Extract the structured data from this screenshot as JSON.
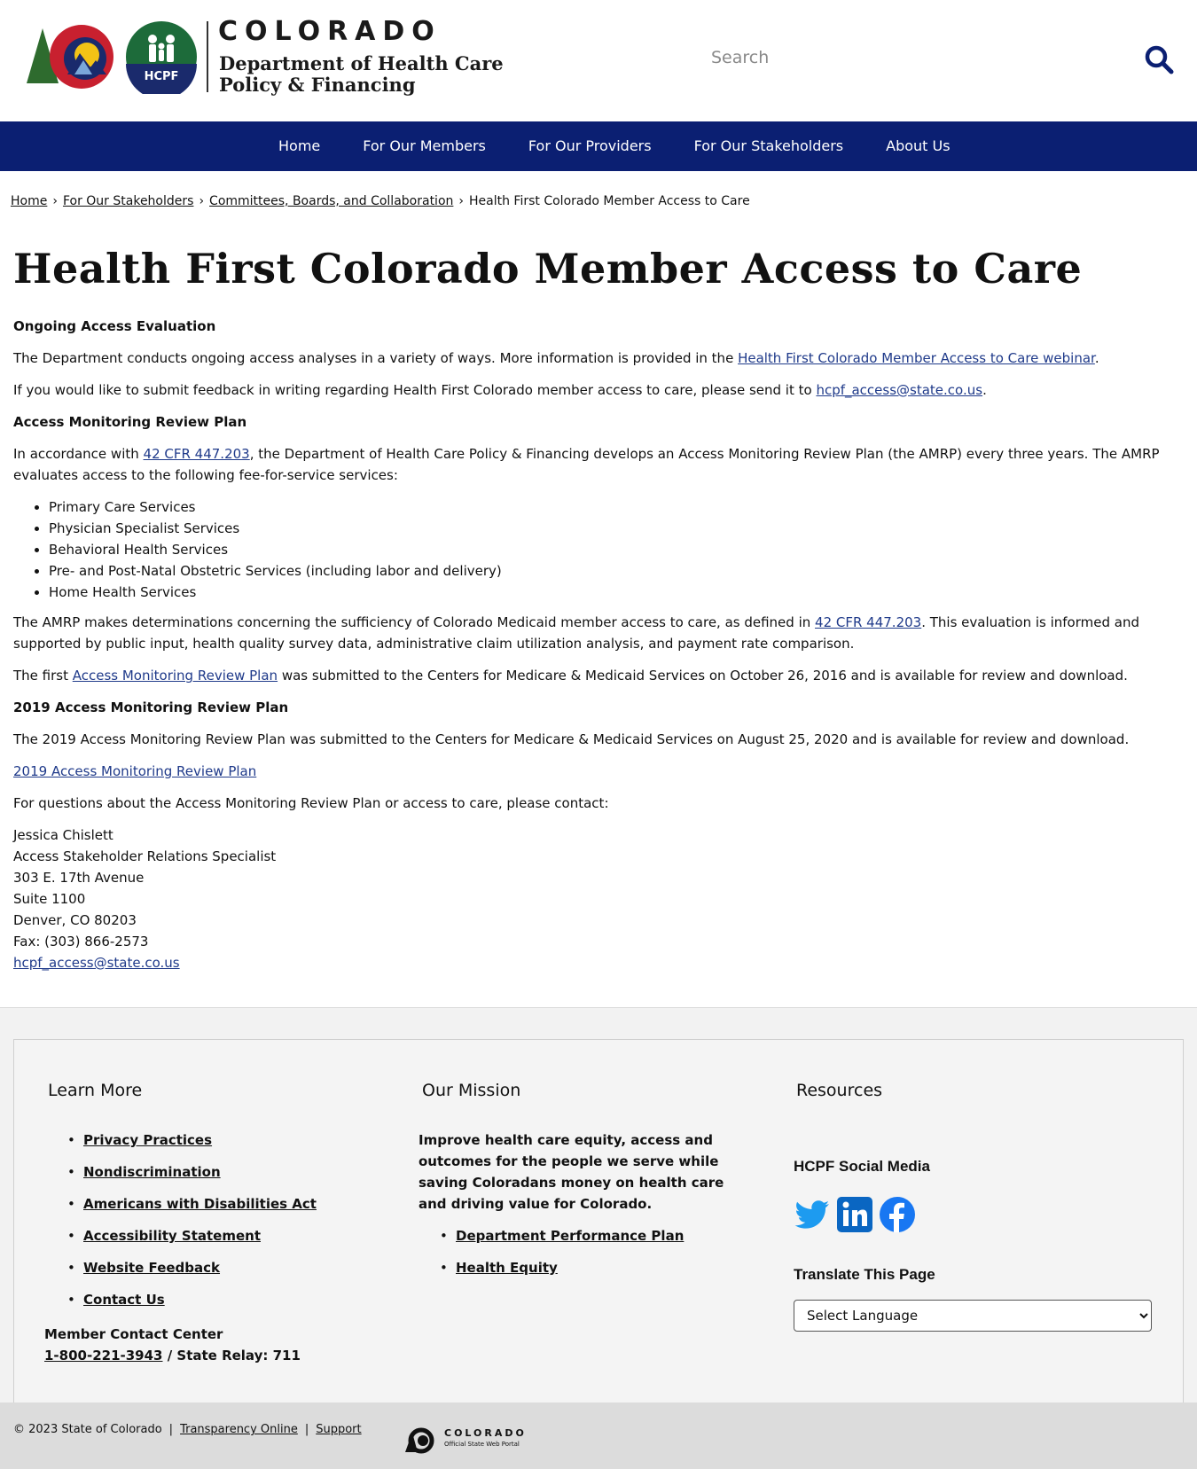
{
  "header": {
    "logo_word": "COLORADO",
    "dept_line1": "Department of Health Care",
    "dept_line2": "Policy & Financing",
    "hcpf_badge": "HCPF",
    "search_placeholder": "Search"
  },
  "nav": {
    "items": [
      {
        "label": "Home"
      },
      {
        "label": "For Our Members"
      },
      {
        "label": "For Our Providers"
      },
      {
        "label": "For Our Stakeholders"
      },
      {
        "label": "About Us"
      }
    ]
  },
  "breadcrumb": {
    "items": [
      "Home",
      "For Our Stakeholders",
      "Committees, Boards, and Collaboration"
    ],
    "current": "Health First Colorado Member Access to Care",
    "separator": "›"
  },
  "page_title": "Health First Colorado Member Access to Care",
  "content": {
    "h_ongoing": "Ongoing Access Evaluation",
    "p1_pre": "The Department conducts ongoing access analyses in a variety of ways. More information is provided in the ",
    "p1_link": "Health First Colorado Member Access to Care webinar",
    "p1_post": ".",
    "p2_pre": "If you would like to submit feedback in writing regarding Health First Colorado member access to care, please send it to ",
    "p2_link": "hcpf_access@state.co.us",
    "p2_post": ".",
    "h_amrp": "Access Monitoring Review Plan",
    "p3_pre": "In accordance with ",
    "p3_link": "42 CFR 447.203",
    "p3_post": ", the Department of Health Care Policy & Financing develops an Access Monitoring Review Plan (the AMRP) every three years. The AMRP evaluates access to the following fee-for-service services:",
    "services": [
      "Primary Care Services",
      "Physician Specialist Services",
      "Behavioral Health Services",
      "Pre- and Post-Natal Obstetric Services (including labor and delivery)",
      "Home Health Services"
    ],
    "p4_pre": "The AMRP makes determinations concerning the sufficiency of Colorado Medicaid member access to care, as defined in ",
    "p4_link": "42 CFR 447.203",
    "p4_post": ".  This evaluation is informed and supported by public input, health quality survey data, administrative claim utilization analysis, and payment rate comparison.",
    "p5_pre": "The first ",
    "p5_link": "Access Monitoring Review Plan",
    "p5_post": " was submitted to the Centers for Medicare & Medicaid Services on October 26, 2016 and is available for review and download.",
    "h_2019": "2019 Access Monitoring Review Plan",
    "p6": "The 2019 Access Monitoring Review Plan was submitted to the Centers for Medicare & Medicaid Services on August 25, 2020 and is available for review and download.",
    "link_2019": "2019 Access Monitoring Review Plan",
    "p7": "For questions about the Access Monitoring Review Plan or access to care, please contact:",
    "contact": {
      "name": "Jessica Chislett",
      "title": "Access Stakeholder Relations Specialist",
      "addr1": "303 E. 17th Avenue",
      "addr2": "Suite 1100",
      "city": "Denver, CO 80203",
      "fax": "Fax: (303) 866-2573",
      "email": "hcpf_access@state.co.us"
    }
  },
  "footer": {
    "learn_more": {
      "title": "Learn More",
      "links": [
        "Privacy Practices",
        "Nondiscrimination",
        "Americans with Disabilities Act",
        "Accessibility Statement",
        "Website Feedback",
        "Contact Us"
      ]
    },
    "member_center": {
      "label": "Member Contact Center",
      "phone": "1-800-221-3943",
      "relay": " / State Relay: 711"
    },
    "mission": {
      "title": "Our Mission",
      "text": "Improve health care equity, access and outcomes for the people we serve while saving Coloradans money on health care and driving value for Colorado.",
      "links": [
        "Department Performance Plan",
        "Health Equity"
      ]
    },
    "resources": {
      "title": "Resources",
      "social_title": "HCPF Social Media",
      "social": [
        "twitter-icon",
        "linkedin-icon",
        "facebook-icon"
      ],
      "translate_title": "Translate This Page",
      "select_value": "Select Language"
    }
  },
  "bottom": {
    "copyright": "© 2023 State of Colorado",
    "links": [
      "Transparency Online",
      "Support"
    ],
    "portal_word": "COLORADO",
    "portal_sub": "Official State Web Portal"
  },
  "colors": {
    "nav_bg": "#0b1f72",
    "link": "#1f3a8a",
    "footer_bg": "#f2f2f2",
    "bottom_bg": "#dcdcdc",
    "social_blue_twitter": "#1d9bf0",
    "social_blue_linkedin": "#0a66c2"
  }
}
